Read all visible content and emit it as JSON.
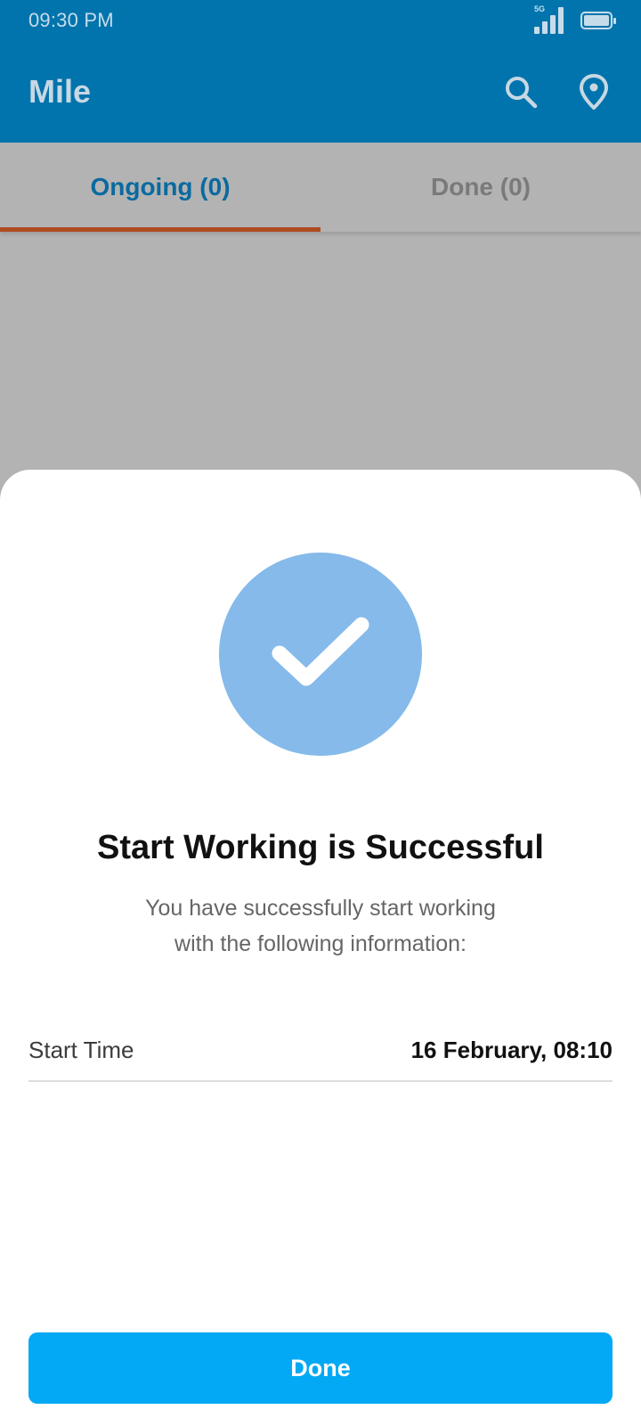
{
  "status_bar": {
    "time": "09:30 PM",
    "network": "5G",
    "icons": [
      "signal-icon",
      "battery-icon"
    ]
  },
  "app_bar": {
    "title": "Mile",
    "actions": [
      "search-icon",
      "location-pin-icon"
    ]
  },
  "tabs": [
    {
      "label": "Ongoing (0)",
      "active": true
    },
    {
      "label": "Done (0)",
      "active": false
    }
  ],
  "sheet": {
    "icon": "checkmark-icon",
    "title": "Start Working is Successful",
    "message_line1": "You have successfully start working",
    "message_line2": "with the following information:",
    "fields": [
      {
        "label": "Start Time",
        "value": "16 February, 08:10"
      }
    ],
    "done_label": "Done"
  },
  "colors": {
    "primary": "#0174ad",
    "tab_indicator": "#b04a1f",
    "success_badge": "#85baea",
    "button": "#03a9f4",
    "overlay": "#b3b3b3"
  }
}
